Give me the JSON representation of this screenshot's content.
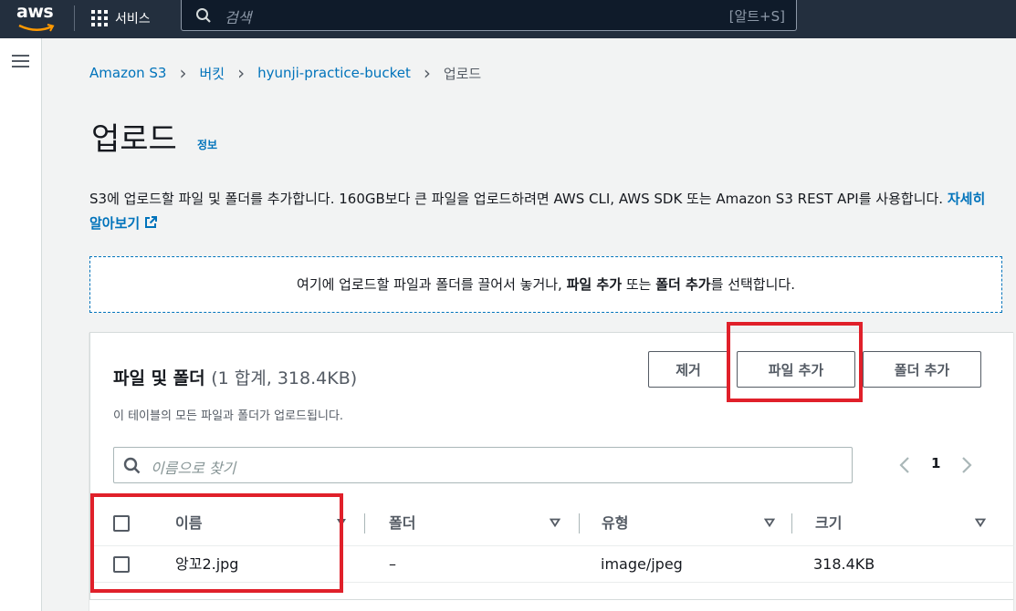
{
  "topnav": {
    "logo_text": "aws",
    "services_label": "서비스",
    "search_placeholder": "검색",
    "search_shortcut": "[알트+S]"
  },
  "breadcrumb": {
    "items": [
      "Amazon S3",
      "버킷",
      "hyunji-practice-bucket"
    ],
    "current": "업로드"
  },
  "page": {
    "title": "업로드",
    "info_link": "정보",
    "description": "S3에 업로드할 파일 및 폴더를 추가합니다. 160GB보다 큰 파일을 업로드하려면 AWS CLI, AWS SDK 또는 Amazon S3 REST API를 사용합니다.",
    "learn_more": "자세히 알아보기"
  },
  "dropzone": {
    "prefix": "여기에 업로드할 파일과 폴더를 끌어서 놓거나, ",
    "add_files": "파일 추가",
    "middle": " 또는 ",
    "add_folder": "폴더 추가",
    "suffix": "를 선택합니다."
  },
  "files_panel": {
    "title": "파일 및 폴더",
    "count": "(1 합계, 318.4KB)",
    "subtitle": "이 테이블의 모든 파일과 폴더가 업로드됩니다.",
    "buttons": {
      "remove": "제거",
      "add_files": "파일 추가",
      "add_folder": "폴더 추가"
    },
    "search_placeholder": "이름으로 찾기",
    "page_number": "1",
    "columns": [
      "이름",
      "폴더",
      "유형",
      "크기"
    ],
    "rows": [
      {
        "name": "앙꼬2.jpg",
        "folder": "–",
        "type": "image/jpeg",
        "size": "318.4KB"
      }
    ]
  },
  "colors": {
    "topbar": "#232f3e",
    "link": "#0073bb",
    "highlight": "#e0202a"
  }
}
